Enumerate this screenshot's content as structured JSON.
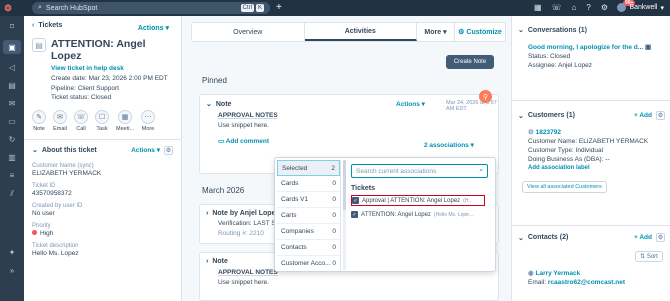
{
  "topbar": {
    "search_placeholder": "Search HubSpot",
    "kbd1": "Ctrl",
    "kbd2": "K",
    "notif_count": "99+",
    "user_name": "Bankwell"
  },
  "left": {
    "back_label": "Tickets",
    "actions_label": "Actions",
    "title": "ATTENTION: Angel Lopez",
    "view_link": "View ticket in help desk",
    "create_date": "Create date: Mar 23, 2026 2:00 PM EDT",
    "pipeline": "Pipeline: Client Support",
    "status": "Ticket status: Closed",
    "action_buttons": [
      "Note",
      "Email",
      "Call",
      "Task",
      "Meeti...",
      "More"
    ],
    "about_title": "About this ticket",
    "about_actions": "Actions",
    "fields": [
      {
        "label": "Customer Name (sync)",
        "value": "ELIZABETH YERMACK"
      },
      {
        "label": "Ticket ID",
        "value": "43570958372"
      },
      {
        "label": "Created by user ID",
        "value": "No user"
      },
      {
        "label": "Priority",
        "value": "High"
      },
      {
        "label": "Ticket description",
        "value": "Hello Ms. Lopez"
      }
    ]
  },
  "center": {
    "tabs": [
      "Overview",
      "Activities",
      "More",
      "Customize"
    ],
    "create_note": "Create Note",
    "pinned_label": "Pinned",
    "note_title": "Note",
    "note_actions": "Actions",
    "note_date": "Mar 24, 2026 at 8:57 AM EDT",
    "note_body1": "APPROVAL NOTES",
    "note_body2": "Use snippet here.",
    "add_comment": "Add comment",
    "associations": "2 associations",
    "march_label": "March 2026",
    "card2_title": "Note by Anjel Lopez",
    "card2_body": "Verification: LAST S",
    "card2_sub": "Routing #: 2210",
    "card3_title": "Note",
    "card3_body1": "APPROVAL NOTES",
    "card3_body2": "Use snippet here."
  },
  "dropdown": {
    "categories": [
      {
        "name": "Selected",
        "count": "2"
      },
      {
        "name": "Cards",
        "count": "0"
      },
      {
        "name": "Cards V1",
        "count": "0"
      },
      {
        "name": "Carts",
        "count": "0"
      },
      {
        "name": "Companies",
        "count": "0"
      },
      {
        "name": "Contacts",
        "count": "0"
      },
      {
        "name": "Customer Acco...",
        "count": "0"
      }
    ],
    "search_placeholder": "Search current associations",
    "tickets_label": "Tickets",
    "ticket1": "Approval | ATTENTION: Angel Lopez",
    "ticket1_sub": "(H...",
    "ticket2": "ATTENTION: Angel Lopez",
    "ticket2_sub": "(Hello Ms. Lope..."
  },
  "right": {
    "conversations_title": "Conversations (1)",
    "conv_link": "Good morning, I apologize for the d...",
    "conv_status": "Status: Closed",
    "conv_assignee": "Assignee: Anjel Lopez",
    "customers_title": "Customers (1)",
    "add_label": "Add",
    "cust_id": "1823792",
    "cust_name": "Customer Name: ELIZABETH YERMACK",
    "cust_type": "Customer Type: Individual",
    "cust_dba": "Doing Business As (DBA): --",
    "add_assoc_label": "Add association label",
    "view_all": "View all associated Customers",
    "contacts_title": "Contacts (2)",
    "sort": "Sort",
    "contact_name": "Larry Yermack",
    "contact_email_label": "Email:",
    "contact_email": "rcaastro62@comcast.net"
  }
}
